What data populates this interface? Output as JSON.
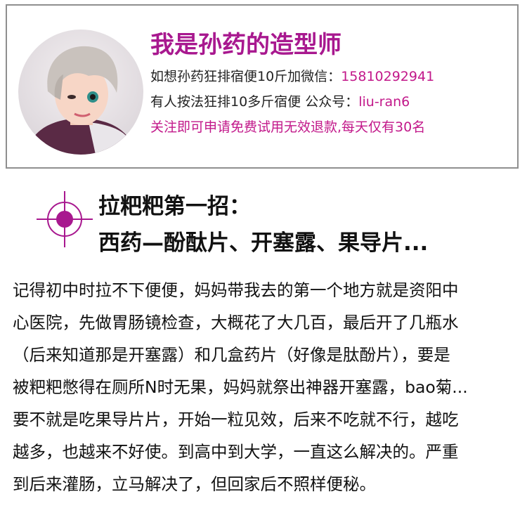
{
  "profile": {
    "avatar_icon": "user-avatar-photo",
    "title": "我是孙药的造型师",
    "line1_label": "如想孙药狂排宿便10斤加微信：",
    "line1_value": "15810292941",
    "line2_label": "有人按法狂排10多斤宿便  公众号：",
    "line2_value": "liu-ran6",
    "line3": "关注即可申请免费试用无效退款,每天仅有30名"
  },
  "section": {
    "icon": "target-crosshair-icon",
    "heading_line1": "拉粑粑第一招：",
    "heading_line2": "西药—酚酞片、开塞露、果导片..."
  },
  "body": {
    "lines": [
      "记得初中时拉不下便便，妈妈带我去的第一个地方就是资阳中",
      "心医院，先做胃肠镜检查，大概花了大几百，最后开了几瓶水",
      "（后来知道那是开塞露）和几盒药片（好像是肽酚片），要是",
      "被粑粑憋得在厕所N时无果，妈妈就祭出神器开塞露，bao菊...",
      "要不就是吃果导片片，开始一粒见效，后来不吃就不行，越吃",
      "越多，也越来不好使。到高中到大学，一直这么解决的。严重",
      "到后来灌肠，立马解决了，但回家后不照样便秘。"
    ]
  },
  "colors": {
    "accent_magenta": "#a8188f",
    "accent_pink": "#c2188a",
    "card_border": "#8f8f8f",
    "text": "#111111"
  }
}
